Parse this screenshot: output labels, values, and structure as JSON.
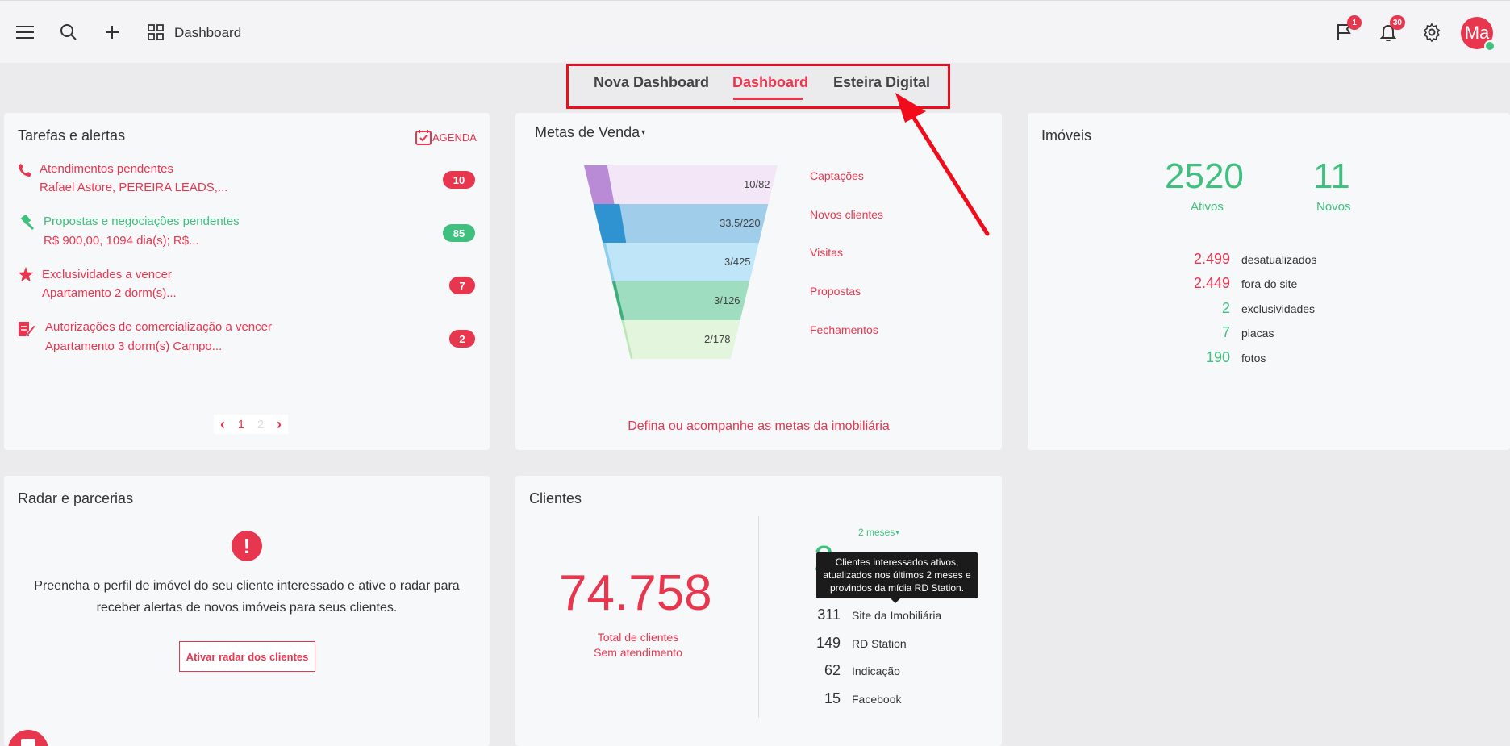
{
  "topbar": {
    "title": "Dashboard",
    "flag_badge": "1",
    "bell_badge": "30",
    "avatar_initials": "Ma"
  },
  "tabs": [
    {
      "label": "Nova Dashboard"
    },
    {
      "label": "Dashboard"
    },
    {
      "label": "Esteira Digital"
    }
  ],
  "tasks": {
    "title": "Tarefas e alertas",
    "agenda_label": "AGENDA",
    "items": [
      {
        "title": "Atendimentos pendentes",
        "subtitle": "Rafael Astore, PEREIRA LEADS,...",
        "count": "10"
      },
      {
        "title": "Propostas e negociações pendentes",
        "subtitle": "R$ 900,00, 1094 dia(s); R$...",
        "count": "85"
      },
      {
        "title": "Exclusividades a vencer",
        "subtitle": "Apartamento 2 dorm(s)...",
        "count": "7"
      },
      {
        "title": "Autorizações de comercialização a vencer",
        "subtitle": "Apartamento 3 dorm(s) Campo...",
        "count": "2"
      }
    ],
    "pagination": {
      "page1": "1",
      "page2": "2"
    }
  },
  "metas": {
    "title": "Metas de Venda",
    "stages": [
      {
        "label": "Captações",
        "value": "10/82"
      },
      {
        "label": "Novos clientes",
        "value": "33.5/220"
      },
      {
        "label": "Visitas",
        "value": "3/425"
      },
      {
        "label": "Propostas",
        "value": "3/126"
      },
      {
        "label": "Fechamentos",
        "value": "2/178"
      }
    ],
    "progress": [
      0.12,
      0.15,
      0.007,
      0.024,
      0.011
    ],
    "footer_link": "Defina ou acompanhe as metas da imobiliária"
  },
  "imoveis": {
    "title": "Imóveis",
    "ativos_num": "2520",
    "ativos_lbl": "Ativos",
    "novos_num": "11",
    "novos_lbl": "Novos",
    "stats": [
      {
        "num": "2.499",
        "label": "desatualizados"
      },
      {
        "num": "2.449",
        "label": "fora do site"
      },
      {
        "num": "2",
        "label": "exclusividades"
      },
      {
        "num": "7",
        "label": "placas"
      },
      {
        "num": "190",
        "label": "fotos"
      }
    ]
  },
  "radar": {
    "title": "Radar e parcerias",
    "message_line1": "Preencha o perfil de imóvel do seu cliente interessado e ative o radar para",
    "message_line2": "receber alertas de novos imóveis para seus clientes.",
    "button": "Ativar radar dos clientes"
  },
  "clientes": {
    "title": "Clientes",
    "total": "74.758",
    "total_lbl1": "Total de clientes",
    "total_lbl2": "Sem atendimento",
    "period": "2 meses",
    "sources": [
      {
        "num": "311",
        "label": "Site da Imobiliária"
      },
      {
        "num": "149",
        "label": "RD Station"
      },
      {
        "num": "62",
        "label": "Indicação"
      },
      {
        "num": "15",
        "label": "Facebook"
      }
    ],
    "tooltip_line1": "Clientes interessados ativos,",
    "tooltip_line2": "atualizados nos últimos 2 meses e",
    "tooltip_line3": "provindos da mídia RD Station."
  },
  "colors": {
    "accent": "#e8364f",
    "green": "#3fc07f",
    "highlight": "#f00c1a"
  }
}
